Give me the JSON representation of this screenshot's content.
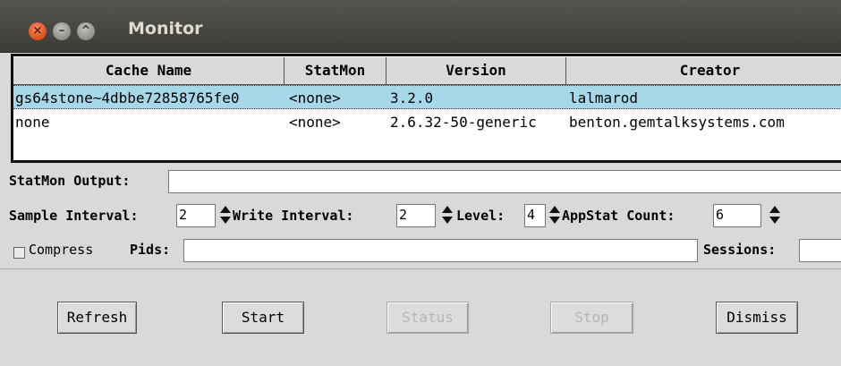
{
  "window": {
    "title": "Monitor"
  },
  "table": {
    "columns": [
      "Cache Name",
      "StatMon",
      "Version",
      "Creator"
    ],
    "rows": [
      {
        "cache_name": "gs64stone~4dbbe72858765fe0",
        "statmon": "<none>",
        "version": "3.2.0",
        "creator": "lalmarod",
        "selected": true
      },
      {
        "cache_name": "none",
        "statmon": "<none>",
        "version": "2.6.32-50-generic",
        "creator": "benton.gemtalksystems.com",
        "selected": false
      }
    ]
  },
  "statmon_output": {
    "label": "StatMon Output:",
    "value": ""
  },
  "settings": {
    "sample_interval": {
      "label": "Sample Interval:",
      "value": "2"
    },
    "write_interval": {
      "label": "Write Interval:",
      "value": "2"
    },
    "level": {
      "label": "Level:",
      "value": "4"
    },
    "appstat_count": {
      "label": "AppStat Count:",
      "value": "6"
    }
  },
  "compress": {
    "label": "Compress"
  },
  "pids": {
    "label": "Pids:",
    "value": ""
  },
  "sessions": {
    "label": "Sessions:",
    "value": ""
  },
  "buttons": {
    "refresh": "Refresh",
    "start": "Start",
    "status": "Status",
    "stop": "Stop",
    "dismiss": "Dismiss"
  },
  "colors": {
    "selection": "#a5d8e9",
    "titlebar": "#3c3b37",
    "close": "#df4b16"
  }
}
